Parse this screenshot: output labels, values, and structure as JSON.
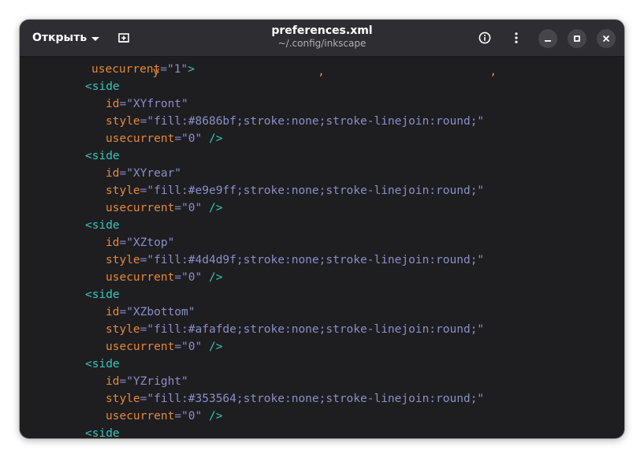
{
  "header": {
    "open_label": "Открыть",
    "title": "preferences.xml",
    "subtitle": "~/.config/inkscape"
  },
  "icons": {
    "open_menu": "chevron-down-icon",
    "new_tab": "new-tab-icon",
    "info": "info-icon",
    "menu": "kebab-menu-icon",
    "minimize": "minimize-icon",
    "maximize": "maximize-icon",
    "close": "close-icon"
  },
  "colors": {
    "tag": "#33c7b9",
    "attribute": "#e6883a",
    "value": "#8b8ec9",
    "background": "#1e1e21",
    "headerbar": "#2e2e32"
  },
  "code": {
    "line0": {
      "text": "   y                       ,                        ,    "
    },
    "line1": {
      "attr": "usecurrent",
      "eq": "=",
      "val": "\"1\"",
      "end": ">"
    },
    "blocks": [
      {
        "tag": "<side",
        "id_attr": "id",
        "id_val": "\"XYfront\"",
        "style_attr": "style",
        "style_val": "\"fill:#8686bf;stroke:none;stroke-linejoin:round;\"",
        "uc_attr": "usecurrent",
        "uc_val": "\"0\"",
        "close": " />"
      },
      {
        "tag": "<side",
        "id_attr": "id",
        "id_val": "\"XYrear\"",
        "style_attr": "style",
        "style_val": "\"fill:#e9e9ff;stroke:none;stroke-linejoin:round;\"",
        "uc_attr": "usecurrent",
        "uc_val": "\"0\"",
        "close": " />"
      },
      {
        "tag": "<side",
        "id_attr": "id",
        "id_val": "\"XZtop\"",
        "style_attr": "style",
        "style_val": "\"fill:#4d4d9f;stroke:none;stroke-linejoin:round;\"",
        "uc_attr": "usecurrent",
        "uc_val": "\"0\"",
        "close": " />"
      },
      {
        "tag": "<side",
        "id_attr": "id",
        "id_val": "\"XZbottom\"",
        "style_attr": "style",
        "style_val": "\"fill:#afafde;stroke:none;stroke-linejoin:round;\"",
        "uc_attr": "usecurrent",
        "uc_val": "\"0\"",
        "close": " />"
      },
      {
        "tag": "<side",
        "id_attr": "id",
        "id_val": "\"YZright\"",
        "style_attr": "style",
        "style_val": "\"fill:#353564;stroke:none;stroke-linejoin:round;\"",
        "uc_attr": "usecurrent",
        "uc_val": "\"0\"",
        "close": " />"
      }
    ],
    "last_tag": "<side"
  }
}
